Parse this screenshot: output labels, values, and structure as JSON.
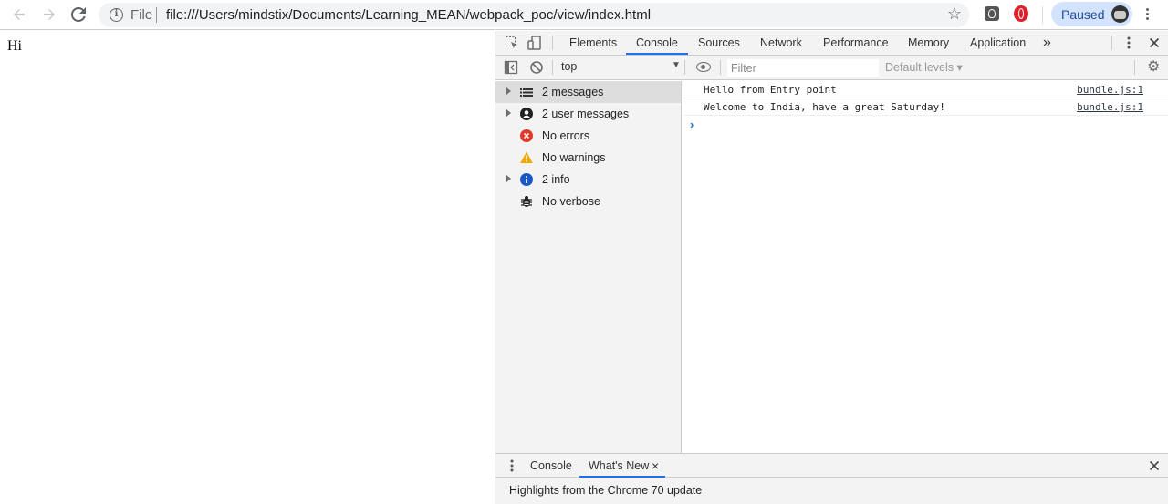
{
  "browser": {
    "file_label": "File",
    "url": "file:///Users/mindstix/Documents/Learning_MEAN/webpack_poc/view/index.html",
    "profile_label": "Paused"
  },
  "page": {
    "body_text": "Hi"
  },
  "devtools": {
    "tabs": [
      "Elements",
      "Console",
      "Sources",
      "Network",
      "Performance",
      "Memory",
      "Application"
    ],
    "active_tab": "Console",
    "more_tabs_label": "»",
    "context": "top",
    "filter_placeholder": "Filter",
    "levels_label": "Default levels ▾",
    "sidebar": [
      {
        "label": "2 messages",
        "icon": "list-icon"
      },
      {
        "label": "2 user messages",
        "icon": "user-icon"
      },
      {
        "label": "No errors",
        "icon": "error-icon"
      },
      {
        "label": "No warnings",
        "icon": "warning-icon"
      },
      {
        "label": "2 info",
        "icon": "info-icon"
      },
      {
        "label": "No verbose",
        "icon": "bug-icon"
      }
    ],
    "messages": [
      {
        "text": "Hello from Entry point",
        "source": "bundle.js:1"
      },
      {
        "text": "Welcome to India, have a great Saturday!",
        "source": "bundle.js:1"
      }
    ],
    "prompt_symbol": "›",
    "drawer_tabs": [
      "Console",
      "What's New"
    ],
    "drawer_close": "×",
    "drawer_text": "Highlights from the Chrome 70 update"
  },
  "colors": {
    "accent": "#1a73e8",
    "error": "#d93025",
    "warning": "#f2a600",
    "info": "#1a73e8"
  }
}
